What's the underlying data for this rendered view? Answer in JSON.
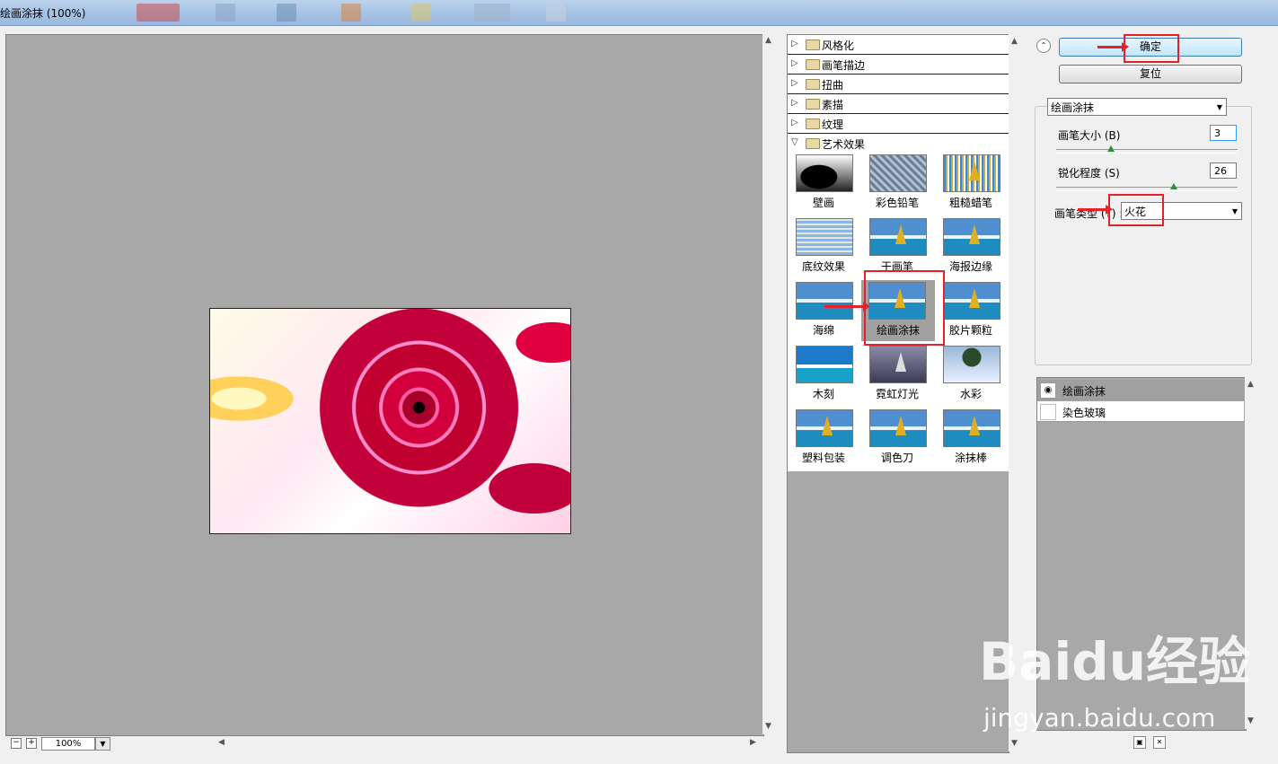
{
  "window": {
    "title": "绘画涂抹 (100%)"
  },
  "preview": {
    "zoom": "100%",
    "zoom_out": "−",
    "zoom_in": "+"
  },
  "categories": [
    {
      "label": "风格化"
    },
    {
      "label": "画笔描边"
    },
    {
      "label": "扭曲"
    },
    {
      "label": "素描"
    },
    {
      "label": "纹理"
    },
    {
      "label": "艺术效果"
    }
  ],
  "thumbnails": [
    {
      "label": "壁画"
    },
    {
      "label": "彩色铅笔"
    },
    {
      "label": "粗糙蜡笔"
    },
    {
      "label": "底纹效果"
    },
    {
      "label": "干画笔"
    },
    {
      "label": "海报边缘"
    },
    {
      "label": "海绵"
    },
    {
      "label": "绘画涂抹"
    },
    {
      "label": "胶片颗粒"
    },
    {
      "label": "木刻"
    },
    {
      "label": "霓虹灯光"
    },
    {
      "label": "水彩"
    },
    {
      "label": "塑料包装"
    },
    {
      "label": "调色刀"
    },
    {
      "label": "涂抹棒"
    }
  ],
  "actions": {
    "ok": "确定",
    "reset": "复位"
  },
  "settings": {
    "filter_select": "绘画涂抹",
    "brush_size_label": "画笔大小 (B)",
    "brush_size_value": "3",
    "brush_size_fraction": 0.3,
    "sharpness_label": "锐化程度 (S)",
    "sharpness_value": "26",
    "sharpness_fraction": 0.65,
    "brush_type_label": "画笔类型 (T) :",
    "brush_type_value": "火花"
  },
  "layers": [
    {
      "name": "绘画涂抹",
      "visible": true
    },
    {
      "name": "染色玻璃",
      "visible": false
    }
  ],
  "watermark": {
    "brand": "Baidu经验",
    "url": "jingyan.baidu.com"
  },
  "colors": {
    "accent": "#e52229",
    "canvas": "#a8a8a8"
  }
}
